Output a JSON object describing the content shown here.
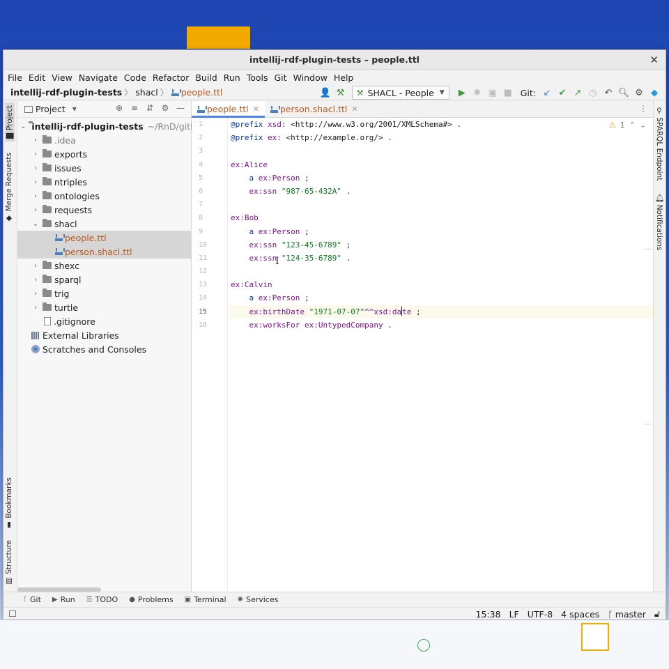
{
  "window": {
    "title": "intellij-rdf-plugin-tests – people.ttl"
  },
  "menu": [
    "File",
    "Edit",
    "View",
    "Navigate",
    "Code",
    "Refactor",
    "Build",
    "Run",
    "Tools",
    "Git",
    "Window",
    "Help"
  ],
  "breadcrumb": {
    "project": "intellij-rdf-plugin-tests",
    "folder": "shacl",
    "file": "people.ttl"
  },
  "toolbar": {
    "run_config": "SHACL - People",
    "git_label": "Git:"
  },
  "left_tabs": {
    "project": "Project",
    "merge": "Merge Requests",
    "bookmarks": "Bookmarks",
    "structure": "Structure"
  },
  "right_tabs": {
    "sparql": "SPARQL Endpoint",
    "notifications": "Notifications"
  },
  "project_panel": {
    "header": "Project",
    "root": {
      "name": "intellij-rdf-plugin-tests",
      "path": "~/RnD/gitla"
    },
    "folders": [
      ".idea",
      "exports",
      "issues",
      "ntriples",
      "ontologies",
      "requests"
    ],
    "shacl": {
      "name": "shacl",
      "files": [
        "people.ttl",
        "person.shacl.ttl"
      ]
    },
    "folders_after": [
      "shexc",
      "sparql",
      "trig",
      "turtle"
    ],
    "gitignore": ".gitignore",
    "external_libraries": "External Libraries",
    "scratches": "Scratches and Consoles"
  },
  "editor": {
    "tabs": [
      {
        "label": "people.ttl"
      },
      {
        "label": "person.shacl.ttl"
      }
    ],
    "inspection": {
      "warn": "⚠",
      "count": "1"
    },
    "line_numbers": [
      "1",
      "2",
      "3",
      "4",
      "5",
      "6",
      "7",
      "8",
      "9",
      "10",
      "11",
      "12",
      "13",
      "14",
      "15",
      "16"
    ],
    "code": {
      "l1_kw": "@prefix",
      "l1_pfx": "xsd:",
      "l1_iri": "<http://www.w3.org/2001/XMLSchema#>",
      "l1_end": ".",
      "l2_kw": "@prefix",
      "l2_pfx": "ex:",
      "l2_iri": "<http://example.org/>",
      "l2_end": ".",
      "l4": "ex:Alice",
      "l5_a": "a",
      "l5_cls": "ex:Person",
      "l5_end": ";",
      "l6_p": "ex:ssn",
      "l6_v": "\"987-65-432A\"",
      "l6_end": ".",
      "l8": "ex:Bob",
      "l9_a": "a",
      "l9_cls": "ex:Person",
      "l9_end": ";",
      "l10_p": "ex:ssn",
      "l10_v": "\"123-45-6789\"",
      "l10_end": ";",
      "l11_p": "ex:ssn",
      "l11_v": "\"124-35-6789\"",
      "l11_end": ".",
      "l13": "ex:Calvin",
      "l14_a": "a",
      "l14_cls": "ex:Person",
      "l14_end": ";",
      "l15_p": "ex:birthDate",
      "l15_v": "\"1971-07-07\"",
      "l15_dt1": "^^xsd:da",
      "l15_dt2": "te",
      "l15_end": ";",
      "l16_p": "ex:worksFor",
      "l16_v": "ex:UntypedCompany",
      "l16_end": "."
    }
  },
  "bottom_tools": [
    "Git",
    "Run",
    "TODO",
    "Problems",
    "Terminal",
    "Services"
  ],
  "status": {
    "position": "15:38",
    "line_sep": "LF",
    "encoding": "UTF-8",
    "indent": "4 spaces",
    "branch": "master"
  },
  "colors": {
    "accent": "#4a86e8",
    "file_modified": "#b85a1d",
    "keyword": "#0033b3",
    "prefix": "#871094",
    "string": "#067d17"
  }
}
